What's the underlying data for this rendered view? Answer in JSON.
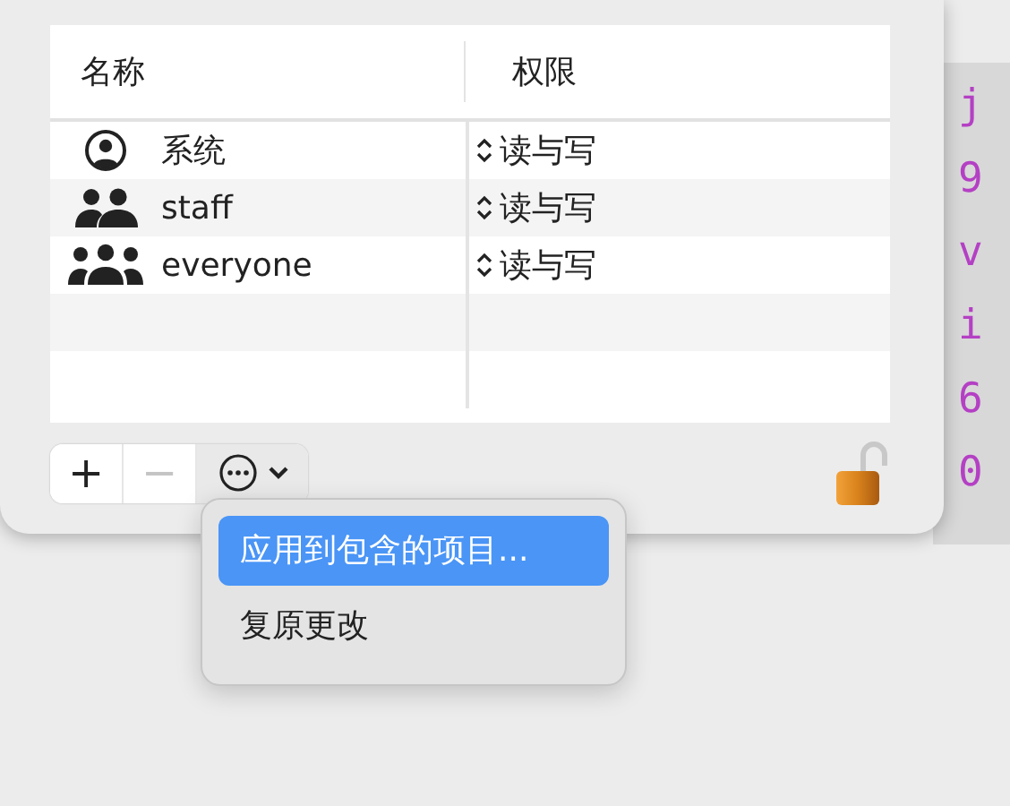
{
  "table": {
    "columns": [
      "名称",
      "权限"
    ],
    "rows": [
      {
        "kind": "user",
        "name": "系统",
        "permission": "读与写"
      },
      {
        "kind": "group",
        "name": "staff",
        "permission": "读与写"
      },
      {
        "kind": "everyone",
        "name": "everyone",
        "permission": "读与写"
      }
    ]
  },
  "toolbar": {
    "buttons": [
      {
        "kind": "add",
        "label": "+",
        "disabled": false,
        "pressed": false
      },
      {
        "kind": "remove",
        "label": "−",
        "disabled": true,
        "pressed": false
      },
      {
        "kind": "action",
        "disabled": false,
        "pressed": true
      }
    ]
  },
  "lock": {
    "locked": false
  },
  "menu": {
    "items": [
      {
        "label": "应用到包含的项目...",
        "selected": true
      },
      {
        "label": "复原更改",
        "selected": false
      }
    ]
  },
  "background_code": {
    "lines": [
      "j",
      "9",
      "v",
      "i",
      "6",
      "0"
    ]
  }
}
